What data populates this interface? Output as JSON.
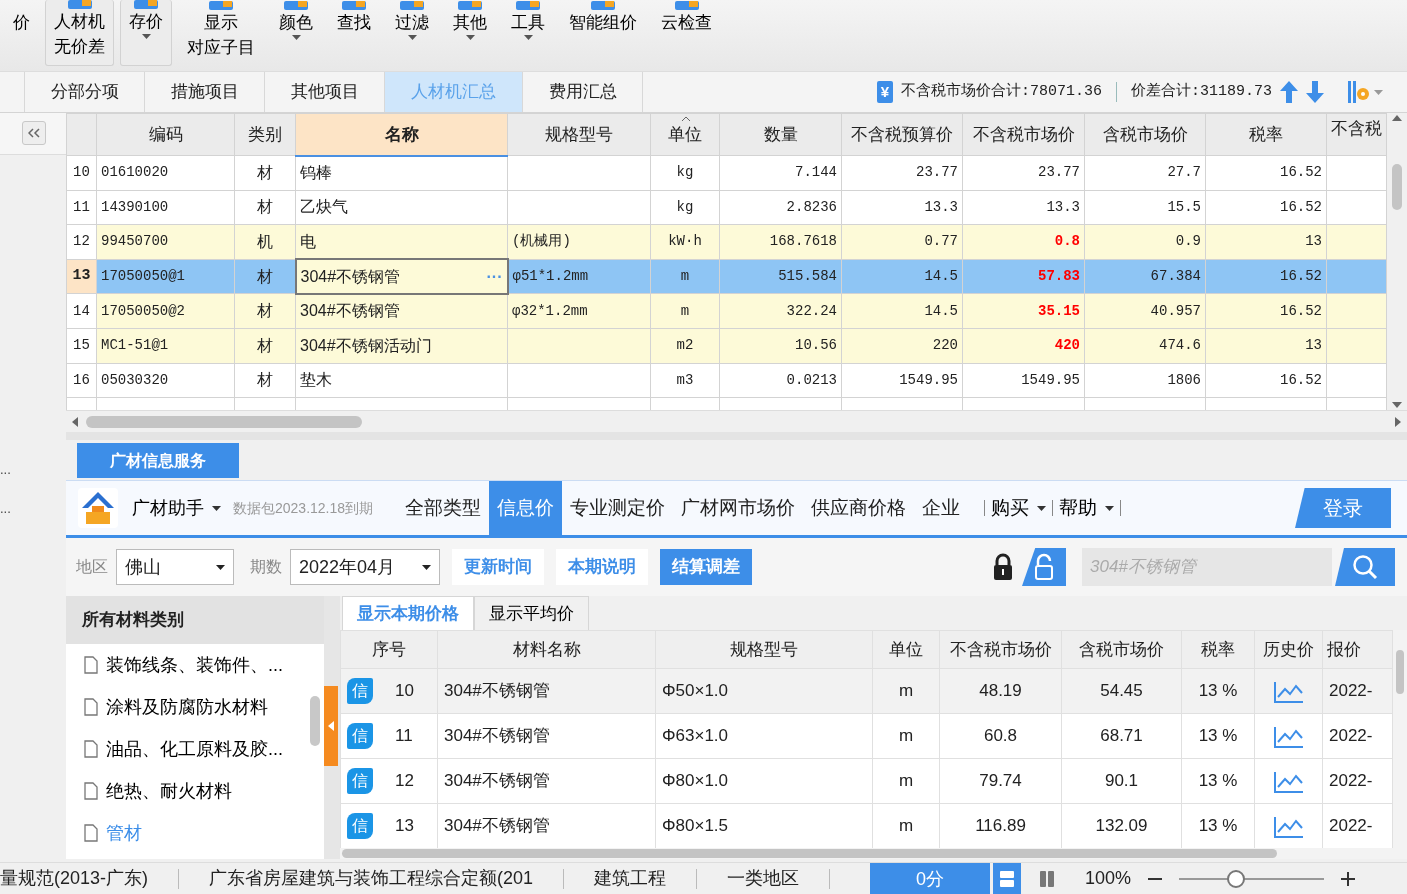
{
  "ribbon": {
    "buttons": [
      {
        "lines": [
          "价"
        ],
        "caret": false,
        "framed": false,
        "icon": false
      },
      {
        "lines": [
          "人材机",
          "无价差"
        ],
        "caret": false,
        "framed": true,
        "icon": true
      },
      {
        "lines": [
          "存价"
        ],
        "caret": true,
        "framed": true,
        "icon": true
      },
      {
        "lines": [
          "显示",
          "对应子目"
        ],
        "caret": false,
        "framed": false,
        "icon": true
      },
      {
        "lines": [
          "颜色"
        ],
        "caret": true,
        "framed": false,
        "icon": true
      },
      {
        "lines": [
          "查找"
        ],
        "caret": false,
        "framed": false,
        "icon": true
      },
      {
        "lines": [
          "过滤"
        ],
        "caret": true,
        "framed": false,
        "icon": true
      },
      {
        "lines": [
          "其他"
        ],
        "caret": true,
        "framed": false,
        "icon": true
      },
      {
        "lines": [
          "工具"
        ],
        "caret": true,
        "framed": false,
        "icon": true
      },
      {
        "lines": [
          "智能组价"
        ],
        "caret": false,
        "framed": false,
        "icon": true
      },
      {
        "lines": [
          "云检查"
        ],
        "caret": false,
        "framed": false,
        "icon": true
      }
    ]
  },
  "tabs": [
    {
      "label": "分部分项",
      "selected": false
    },
    {
      "label": "措施项目",
      "selected": false
    },
    {
      "label": "其他项目",
      "selected": false
    },
    {
      "label": "人材机汇总",
      "selected": true
    },
    {
      "label": "费用汇总",
      "selected": false
    }
  ],
  "summary": {
    "currency_symbol": "¥",
    "market_total": "不含税市场价合计:78071.36",
    "diff_total": "价差合计:31189.73"
  },
  "left_marks": [
    "...",
    "..."
  ],
  "grid": {
    "columns": [
      {
        "label": "编码",
        "active": false
      },
      {
        "label": "类别",
        "active": false
      },
      {
        "label": "名称",
        "active": true
      },
      {
        "label": "规格型号",
        "active": false
      },
      {
        "label": "单位",
        "active": false
      },
      {
        "label": "数量",
        "active": false
      },
      {
        "label": "不含税预算价",
        "active": false
      },
      {
        "label": "不含税市场价",
        "active": false
      },
      {
        "label": "含税市场价",
        "active": false
      },
      {
        "label": "税率",
        "active": false
      },
      {
        "label": "不含税",
        "active": false
      }
    ],
    "rows": [
      {
        "number": "10",
        "code": "01610020",
        "type": "材",
        "name": "钨棒",
        "unit": "kg",
        "quantity": "7.144",
        "budget_price": "23.77",
        "market_price": "23.77",
        "market_changed": false,
        "tax_price": "27.7",
        "tax_rate": "16.52",
        "highlighted": false,
        "selected": false,
        "editing": false
      },
      {
        "number": "11",
        "code": "14390100",
        "type": "材",
        "name": "乙炔气",
        "unit": "kg",
        "quantity": "2.8236",
        "budget_price": "13.3",
        "market_price": "13.3",
        "market_changed": false,
        "tax_price": "15.5",
        "tax_rate": "16.52",
        "highlighted": false,
        "selected": false,
        "editing": false
      },
      {
        "number": "12",
        "code": "99450700",
        "type": "机",
        "name": "电",
        "spec": "(机械用)",
        "unit": "kW·h",
        "quantity": "168.7618",
        "budget_price": "0.77",
        "market_price": "0.8",
        "market_changed": true,
        "tax_price": "0.9",
        "tax_rate": "13",
        "highlighted": true,
        "selected": false,
        "editing": false
      },
      {
        "number": "13",
        "code": "17050050@1",
        "type": "材",
        "name": "304#不锈钢管",
        "edit_button": "···",
        "spec": "φ51*1.2mm",
        "unit": "m",
        "quantity": "515.584",
        "budget_price": "14.5",
        "market_price": "57.83",
        "market_changed": true,
        "tax_price": "67.384",
        "tax_rate": "16.52",
        "highlighted": true,
        "selected": true,
        "editing": true
      },
      {
        "number": "14",
        "code": "17050050@2",
        "type": "材",
        "name": "304#不锈钢管",
        "spec": "φ32*1.2mm",
        "unit": "m",
        "quantity": "322.24",
        "budget_price": "14.5",
        "market_price": "35.15",
        "market_changed": true,
        "tax_price": "40.957",
        "tax_rate": "16.52",
        "highlighted": true,
        "selected": false,
        "editing": false
      },
      {
        "number": "15",
        "code": "MC1-51@1",
        "type": "材",
        "name": "304#不锈钢活动门",
        "unit": "m2",
        "quantity": "10.56",
        "budget_price": "220",
        "market_price": "420",
        "market_changed": true,
        "tax_price": "474.6",
        "tax_rate": "13",
        "highlighted": true,
        "selected": false,
        "editing": false
      },
      {
        "number": "16",
        "code": "05030320",
        "type": "材",
        "name": "垫木",
        "unit": "m3",
        "quantity": "0.0213",
        "budget_price": "1549.95",
        "market_price": "1549.95",
        "market_changed": false,
        "tax_price": "1806",
        "tax_rate": "16.52",
        "highlighted": false,
        "selected": false,
        "editing": false
      }
    ]
  },
  "info_service": {
    "tab": "广材信息服务",
    "brand": "广材助手",
    "package": "数据包2023.12.18到期",
    "nav": [
      {
        "label": "全部类型",
        "selected": false
      },
      {
        "label": "信息价",
        "selected": true
      },
      {
        "label": "专业测定价",
        "selected": false
      },
      {
        "label": "广材网市场价",
        "selected": false
      },
      {
        "label": "供应商价格",
        "selected": false
      },
      {
        "label": "企业",
        "selected": false
      }
    ],
    "menus": [
      "购买",
      "帮助"
    ],
    "login": "登录",
    "filters": {
      "region_label": "地区",
      "region": "佛山",
      "period_label": "期数",
      "period": "2022年04月"
    },
    "actions": [
      {
        "label": "更新时间",
        "primary": false
      },
      {
        "label": "本期说明",
        "primary": false
      },
      {
        "label": "结算调差",
        "primary": true
      }
    ],
    "search": {
      "placeholder": "304#不锈钢管"
    },
    "categories": {
      "header": "所有材料类别",
      "items": [
        {
          "label": "装饰线条、装饰件、...",
          "selected": false
        },
        {
          "label": "涂料及防腐防水材料",
          "selected": false
        },
        {
          "label": "油品、化工原料及胶...",
          "selected": false
        },
        {
          "label": "绝热、耐火材料",
          "selected": false
        },
        {
          "label": "管材",
          "selected": true
        }
      ]
    },
    "price_tabs": [
      {
        "label": "显示本期价格",
        "selected": true
      },
      {
        "label": "显示平均价",
        "selected": false
      }
    ],
    "price_table": {
      "columns": [
        "序号",
        "材料名称",
        "规格型号",
        "单位",
        "不含税市场价",
        "含税市场价",
        "税率",
        "历史价",
        "报价"
      ],
      "rows": [
        {
          "badge": "信",
          "number": "10",
          "name": "304#不锈钢管",
          "spec": "Φ50×1.0",
          "unit": "m",
          "market_price": "48.19",
          "tax_price": "54.45",
          "tax_rate": "13 %",
          "date": "2022-",
          "selected": true
        },
        {
          "badge": "信",
          "number": "11",
          "name": "304#不锈钢管",
          "spec": "Φ63×1.0",
          "unit": "m",
          "market_price": "60.8",
          "tax_price": "68.71",
          "tax_rate": "13 %",
          "date": "2022-",
          "selected": false
        },
        {
          "badge": "信",
          "number": "12",
          "name": "304#不锈钢管",
          "spec": "Φ80×1.0",
          "unit": "m",
          "market_price": "79.74",
          "tax_price": "90.1",
          "tax_rate": "13 %",
          "date": "2022-",
          "selected": false
        },
        {
          "badge": "信",
          "number": "13",
          "name": "304#不锈钢管",
          "spec": "Φ80×1.5",
          "unit": "m",
          "market_price": "116.89",
          "tax_price": "132.09",
          "tax_rate": "13 %",
          "date": "2022-",
          "selected": false
        }
      ]
    }
  },
  "status_bar": {
    "items": [
      "量规范(2013-广东)",
      "广东省房屋建筑与装饰工程综合定额(201",
      "建筑工程",
      "一类地区"
    ],
    "score": "0分",
    "view_modes": [
      {
        "selected": true
      },
      {
        "selected": false
      }
    ],
    "zoom": "100%",
    "zoom_slider": {
      "level": 0.38
    }
  }
}
